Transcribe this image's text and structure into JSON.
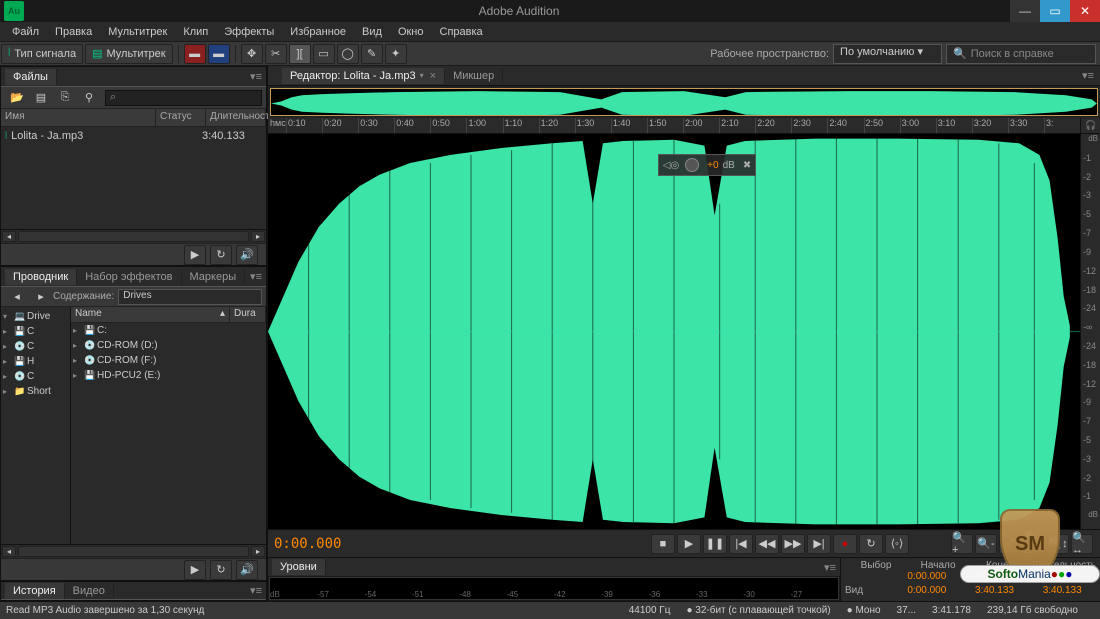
{
  "app": {
    "title": "Adobe Audition",
    "icon_label": "Au"
  },
  "menu": [
    "Файл",
    "Правка",
    "Мультитрек",
    "Клип",
    "Эффекты",
    "Избранное",
    "Вид",
    "Окно",
    "Справка"
  ],
  "toolbar": {
    "signal_type": "Тип сигнала",
    "multitrack": "Мультитрек",
    "workspace_label": "Рабочее пространство:",
    "workspace_value": "По умолчанию",
    "search_placeholder": "Поиск в справке"
  },
  "files_panel": {
    "tab": "Файлы",
    "columns": {
      "name": "Имя",
      "status": "Статус",
      "duration": "Длительность"
    },
    "items": [
      {
        "name": "Lolita - Ja.mp3",
        "duration": "3:40.133"
      }
    ]
  },
  "browser_panel": {
    "tabs": [
      "Проводник",
      "Набор эффектов",
      "Маркеры"
    ],
    "content_label": "Содержание:",
    "drives_label": "Drives",
    "tree": [
      {
        "label": "Drive"
      },
      {
        "label": "C"
      },
      {
        "label": "C"
      },
      {
        "label": "H"
      },
      {
        "label": "C"
      },
      {
        "label": "Short"
      }
    ],
    "list_header": {
      "name": "Name",
      "dur": "Dura"
    },
    "list": [
      {
        "name": "C:"
      },
      {
        "name": "CD-ROM (D:)"
      },
      {
        "name": "CD-ROM (F:)"
      },
      {
        "name": "HD-PCU2 (E:)"
      }
    ]
  },
  "history_panel": {
    "tabs": [
      "История",
      "Видео"
    ]
  },
  "editor": {
    "tab_label": "Редактор: Lolita - Ja.mp3",
    "mixer_tab": "Микшер",
    "timeline_start": "hмс",
    "timeline": [
      "0:10",
      "0:20",
      "0:30",
      "0:40",
      "0:50",
      "1:00",
      "1:10",
      "1:20",
      "1:30",
      "1:40",
      "1:50",
      "2:00",
      "2:10",
      "2:20",
      "2:30",
      "2:40",
      "2:50",
      "3:00",
      "3:10",
      "3:20",
      "3:30",
      "3:"
    ],
    "db_unit": "dB",
    "db_scale_top": [
      "-1",
      "-2",
      "-3",
      "-5",
      "-7",
      "-9",
      "-12",
      "-18",
      "-24",
      "-∞"
    ],
    "db_scale_bot": [
      "-24",
      "-18",
      "-12",
      "-9",
      "-7",
      "-5",
      "-3",
      "-2",
      "-1"
    ],
    "hud_value": "+0",
    "hud_unit": "dB",
    "timecode": "0:00.000"
  },
  "levels": {
    "tab": "Уровни",
    "ticks": [
      "dB",
      "-57",
      "-54",
      "-51",
      "-48",
      "-45",
      "-42",
      "-39",
      "-36",
      "-33",
      "-30",
      "-27"
    ]
  },
  "selection": {
    "label": "Выбор",
    "start": "Начало",
    "end": "Конец",
    "dur": "Длительность",
    "row1_label": "",
    "row1": [
      "0:00.000",
      "0:00.000",
      "0:00.000"
    ],
    "row2_label": "Вид",
    "row2": [
      "0:00.000",
      "3:40.133",
      "3:40.133"
    ]
  },
  "status": {
    "left": "Read MP3 Audio завершено за 1,30 секунд",
    "right": [
      "44100 Гц",
      "32-бит (с плавающей точкой)",
      "Моно",
      "37...",
      "3:41.178",
      "239,14 Гб свободно"
    ]
  },
  "watermark": {
    "badge": "SM",
    "text1": "Softo",
    "text2": "Mania"
  }
}
